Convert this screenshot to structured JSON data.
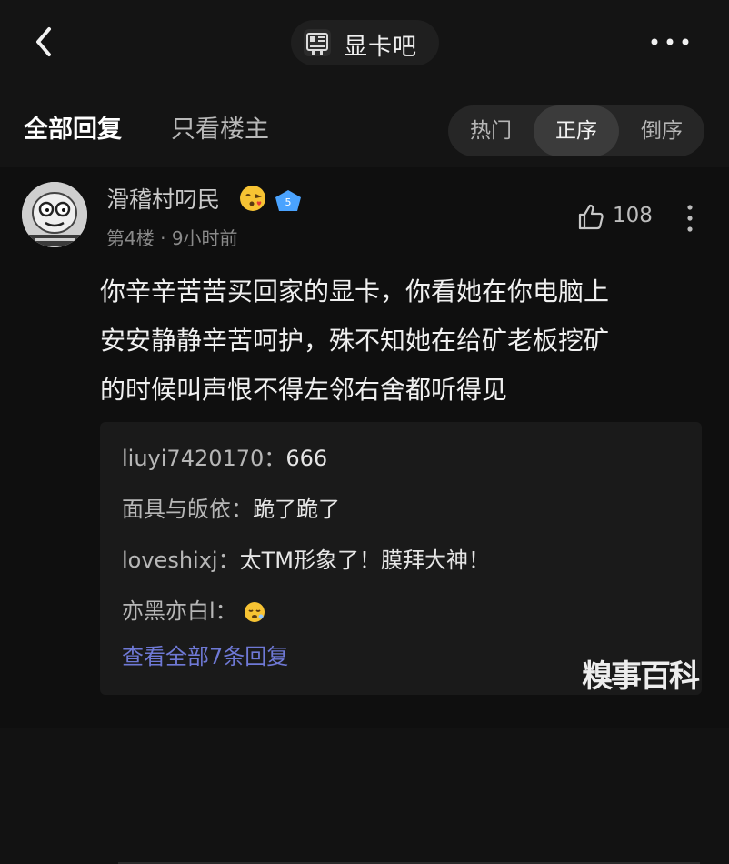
{
  "header": {
    "forum_name": "显卡吧",
    "back_icon": "chevron-left-icon",
    "forum_icon": "forum-logo-icon",
    "more_icon": "more-horizontal-icon"
  },
  "tabs": {
    "all_replies": "全部回复",
    "op_only": "只看楼主",
    "sort": [
      "热门",
      "正序",
      "倒序"
    ],
    "selected_sort": "正序"
  },
  "post": {
    "username": "滑稽村叼民",
    "user_badge_emoji": "face-blowing-kiss-emoji",
    "level": "5",
    "floor": "第4楼",
    "separator": "·",
    "time": "9小时前",
    "likes": "108",
    "body_lines": [
      "你辛辛苦苦买回家的显卡，你看她在你电脑上",
      "安安静静辛苦呵护，殊不知她在给矿老板挖矿",
      "的时候叫声恨不得左邻右舍都听得见"
    ]
  },
  "replies": [
    {
      "name": "liuyi7420170：",
      "text": "666"
    },
    {
      "name": "面具与皈依：",
      "text": "跪了跪了"
    },
    {
      "name": "loveshixj：",
      "text": "太TM形象了！膜拜大神！"
    },
    {
      "name": "亦黑亦白l：",
      "text": "",
      "emoji": "sleepy-face-emoji"
    }
  ],
  "view_all": "查看全部7条回复",
  "watermark": "糗事百科",
  "colors": {
    "background": "#0f0f0f",
    "link": "#6f79d6",
    "badge_blue": "#4aa3ff"
  }
}
